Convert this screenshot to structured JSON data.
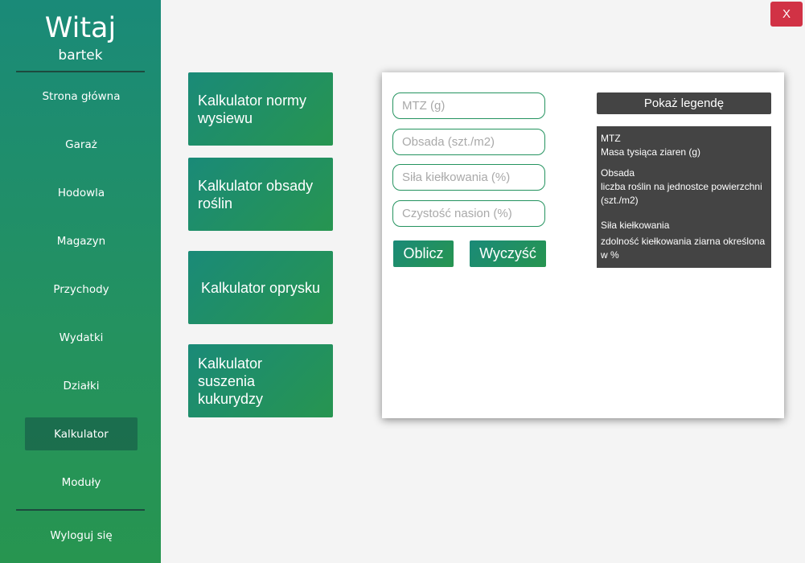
{
  "sidebar": {
    "welcome": "Witaj",
    "username": "bartek",
    "items": [
      {
        "label": "Strona główna"
      },
      {
        "label": "Garaż"
      },
      {
        "label": "Hodowla"
      },
      {
        "label": "Magazyn"
      },
      {
        "label": "Przychody"
      },
      {
        "label": "Wydatki"
      },
      {
        "label": "Działki"
      },
      {
        "label": "Kalkulator",
        "active": true
      },
      {
        "label": "Moduły"
      }
    ],
    "logout": "Wyloguj się"
  },
  "close_label": "X",
  "tiles": [
    {
      "label": "Kalkulator normy wysiewu"
    },
    {
      "label": "Kalkulator obsady roślin"
    },
    {
      "label": "Kalkulator oprysku"
    },
    {
      "label": "Kalkulator suszenia kukurydzy"
    }
  ],
  "form": {
    "mtz_placeholder": "MTZ (g)",
    "obsada_placeholder": "Obsada (szt./m2)",
    "sila_placeholder": "Siła kiełkowania (%)",
    "czystosc_placeholder": "Czystość nasion (%)",
    "calc_label": "Oblicz",
    "clear_label": "Wyczyść"
  },
  "legend": {
    "button_label": "Pokaż legendę",
    "mtz_title": "MTZ",
    "mtz_desc": "Masa tysiąca ziaren (g)",
    "obsada_title": "Obsada",
    "obsada_desc": "liczba roślin na jednostce powierzchni (szt./m2)",
    "sila_title": "Siła kiełkowania",
    "sila_desc": "zdolność kiełkowania ziarna określona w %"
  },
  "colors": {
    "accent_start": "#1a8a78",
    "accent_end": "#279550",
    "close": "#d13245",
    "legend_bg": "#444444"
  }
}
